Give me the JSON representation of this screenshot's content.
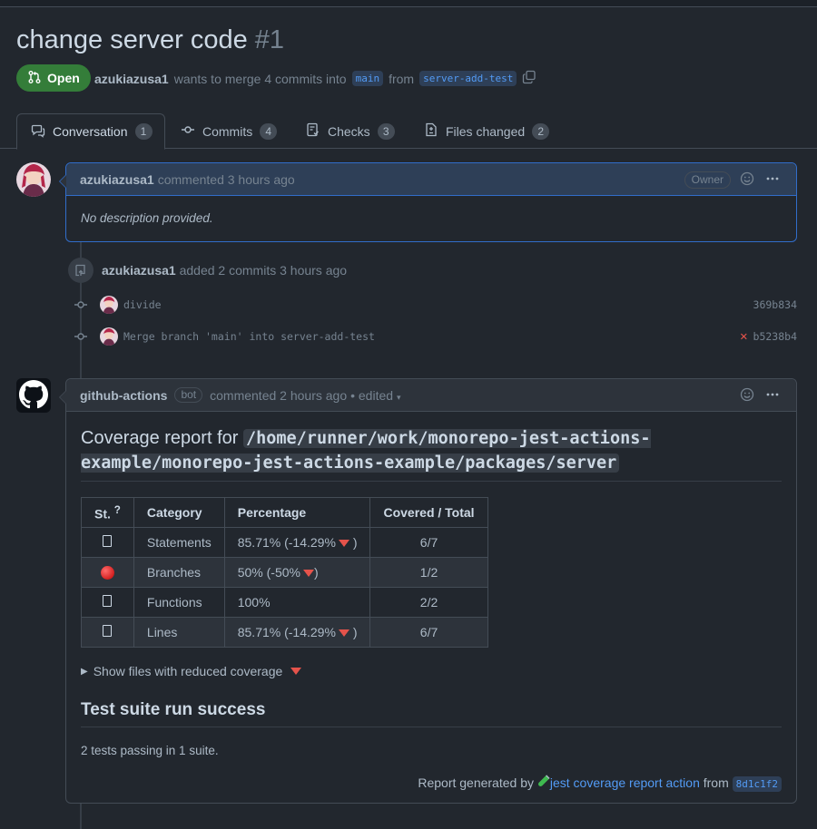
{
  "pr": {
    "title": "change server code",
    "number": "#1",
    "state": "Open",
    "author": "azukiazusa1",
    "merge_text": "wants to merge 4 commits into",
    "base_branch": "main",
    "from_text": "from",
    "head_branch": "server-add-test"
  },
  "tabs": [
    {
      "label": "Conversation",
      "count": "1",
      "icon": "conversation-icon"
    },
    {
      "label": "Commits",
      "count": "4",
      "icon": "commit-icon"
    },
    {
      "label": "Checks",
      "count": "3",
      "icon": "checklist-icon"
    },
    {
      "label": "Files changed",
      "count": "2",
      "icon": "file-diff-icon"
    }
  ],
  "comment1": {
    "author": "azukiazusa1",
    "action": "commented 3 hours ago",
    "badge": "Owner",
    "body": "No description provided."
  },
  "event": {
    "author": "azukiazusa1",
    "text": "added 2 commits 3 hours ago",
    "commits": [
      {
        "message": "divide",
        "sha": "369b834",
        "status": ""
      },
      {
        "message": "Merge branch 'main' into server-add-test",
        "sha": "b5238b4",
        "status": "failed"
      }
    ]
  },
  "comment2": {
    "author": "github-actions",
    "bot_label": "bot",
    "action": "commented 2 hours ago",
    "edited": "• edited",
    "coverage_heading": "Coverage report for",
    "coverage_path": "/home/runner/work/monorepo-jest-actions-example/monorepo-jest-actions-example/packages/server",
    "table_headers": [
      "St.",
      "Category",
      "Percentage",
      "Covered / Total"
    ],
    "table_header_superscript": "?",
    "rows": [
      {
        "status": "box",
        "category": "Statements",
        "percentage": "85.71% (-14.29%",
        "down": true,
        "close": ")",
        "covered": "6/7"
      },
      {
        "status": "red",
        "category": "Branches",
        "percentage": "50% (-50%",
        "down": true,
        "close": ")",
        "covered": "1/2"
      },
      {
        "status": "box",
        "category": "Functions",
        "percentage": "100%",
        "down": false,
        "close": "",
        "covered": "2/2"
      },
      {
        "status": "box",
        "category": "Lines",
        "percentage": "85.71% (-14.29%",
        "down": true,
        "close": ")",
        "covered": "6/7"
      }
    ],
    "details_summary": "Show files with reduced coverage",
    "suite_heading": "Test suite run success",
    "suite_text": "2 tests passing in 1 suite.",
    "footer_prefix": "Report generated by",
    "footer_link": "jest coverage report action",
    "footer_from": "from",
    "footer_sha": "8d1c1f2"
  },
  "colors": {
    "background": "#22272e",
    "accent": "#539bf5",
    "open_green": "#347d39",
    "danger": "#e5534b"
  }
}
